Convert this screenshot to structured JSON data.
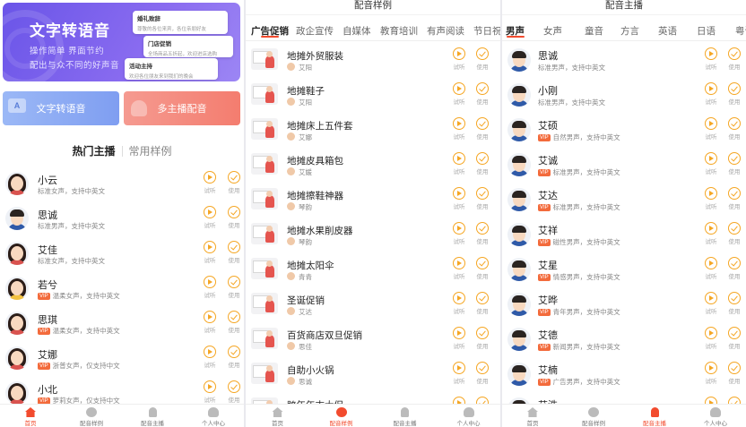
{
  "screen1": {
    "banner": {
      "title": "文字转语音",
      "sub1": "操作简单 界面节约",
      "sub2": "配出与众不同的好声音",
      "cards": [
        {
          "title": "婚礼致辞",
          "tag": "",
          "body": "尊敬的各位来宾，各位亲朋好友"
        },
        {
          "title": "门店促销",
          "tag": "",
          "body": "全场商品五折起，欢迎进店选购"
        },
        {
          "title": "活动主持",
          "tag": "",
          "body": "欢迎各位朋友来到我们的晚会"
        }
      ]
    },
    "actions": {
      "tts": "文字转语音",
      "multi": "多主播配音"
    },
    "segment": {
      "active": "热门主播",
      "inactive": "常用样例"
    },
    "controls": {
      "play": "试听",
      "use": "使用"
    },
    "anchors": [
      {
        "name": "小云",
        "desc": "标准女声，支持中英文",
        "vip": false,
        "gender": "f"
      },
      {
        "name": "思诚",
        "desc": "标准男声，支持中英文",
        "vip": false,
        "gender": "m"
      },
      {
        "name": "艾佳",
        "desc": "标准女声，支持中英文",
        "vip": false,
        "gender": "f"
      },
      {
        "name": "若兮",
        "desc": "温柔女声，支持中英文",
        "vip": true,
        "gender": "y"
      },
      {
        "name": "思琪",
        "desc": "温柔女声，支持中英文",
        "vip": true,
        "gender": "f"
      },
      {
        "name": "艾娜",
        "desc": "浙普女声，仅支持中文",
        "vip": true,
        "gender": "f"
      },
      {
        "name": "小北",
        "desc": "萝莉女声，仅支持中文",
        "vip": true,
        "gender": "f"
      }
    ],
    "nav": [
      {
        "label": "首页",
        "icon": "home",
        "active": true
      },
      {
        "label": "配音样例",
        "icon": "wave",
        "active": false
      },
      {
        "label": "配音主播",
        "icon": "mic",
        "active": false
      },
      {
        "label": "个人中心",
        "icon": "user",
        "active": false
      }
    ]
  },
  "screen2": {
    "header": "配音样例",
    "tabs": [
      "广告促销",
      "政企宣传",
      "自媒体",
      "教育培训",
      "有声阅读",
      "节日祝"
    ],
    "active_tab": 0,
    "samples": [
      {
        "name": "地摊外贸服装",
        "voice": "艾阳"
      },
      {
        "name": "地摊鞋子",
        "voice": "艾阳"
      },
      {
        "name": "地摊床上五件套",
        "voice": "艾娜"
      },
      {
        "name": "地摊皮具箱包",
        "voice": "艾媛"
      },
      {
        "name": "地摊擦鞋神器",
        "voice": "琴韵"
      },
      {
        "name": "地摊水果削皮器",
        "voice": "琴韵"
      },
      {
        "name": "地摊太阳伞",
        "voice": "青青"
      },
      {
        "name": "圣诞促销",
        "voice": "艾达"
      },
      {
        "name": "百货商店双旦促销",
        "voice": "思佳"
      },
      {
        "name": "自助小火锅",
        "voice": "思诚"
      },
      {
        "name": "跨年年末大促",
        "voice": ""
      }
    ],
    "nav": [
      {
        "label": "首页",
        "icon": "home",
        "active": false
      },
      {
        "label": "配音样例",
        "icon": "wave",
        "active": true
      },
      {
        "label": "配音主播",
        "icon": "mic",
        "active": false
      },
      {
        "label": "个人中心",
        "icon": "user",
        "active": false
      }
    ]
  },
  "screen3": {
    "header": "配音主播",
    "tabs": [
      "男声",
      "女声",
      "童音",
      "方言",
      "英语",
      "日语",
      "粤语"
    ],
    "active_tab": 0,
    "anchors": [
      {
        "name": "思诚",
        "desc": "标准男声，支持中英文",
        "vip": false
      },
      {
        "name": "小刚",
        "desc": "标准男声，支持中英文",
        "vip": false
      },
      {
        "name": "艾硕",
        "desc": "自然男声，支持中英文",
        "vip": true
      },
      {
        "name": "艾诚",
        "desc": "标准男声，支持中英文",
        "vip": true
      },
      {
        "name": "艾达",
        "desc": "标准男声，支持中英文",
        "vip": true
      },
      {
        "name": "艾祥",
        "desc": "磁性男声，支持中英文",
        "vip": true
      },
      {
        "name": "艾星",
        "desc": "情感男声，支持中英文",
        "vip": true
      },
      {
        "name": "艾晔",
        "desc": "青年男声，支持中英文",
        "vip": true
      },
      {
        "name": "艾德",
        "desc": "新闻男声，支持中英文",
        "vip": true
      },
      {
        "name": "艾楠",
        "desc": "广告男声，支持中英文",
        "vip": true
      },
      {
        "name": "艾浩",
        "desc": "",
        "vip": false
      }
    ],
    "nav": [
      {
        "label": "首页",
        "icon": "home",
        "active": false
      },
      {
        "label": "配音样例",
        "icon": "wave",
        "active": false
      },
      {
        "label": "配音主播",
        "icon": "mic",
        "active": true
      },
      {
        "label": "个人中心",
        "icon": "user",
        "active": false
      }
    ]
  },
  "colors": {
    "accent": "#f5a623",
    "brand": "#f24b2e",
    "banner": "#7a62ee"
  }
}
